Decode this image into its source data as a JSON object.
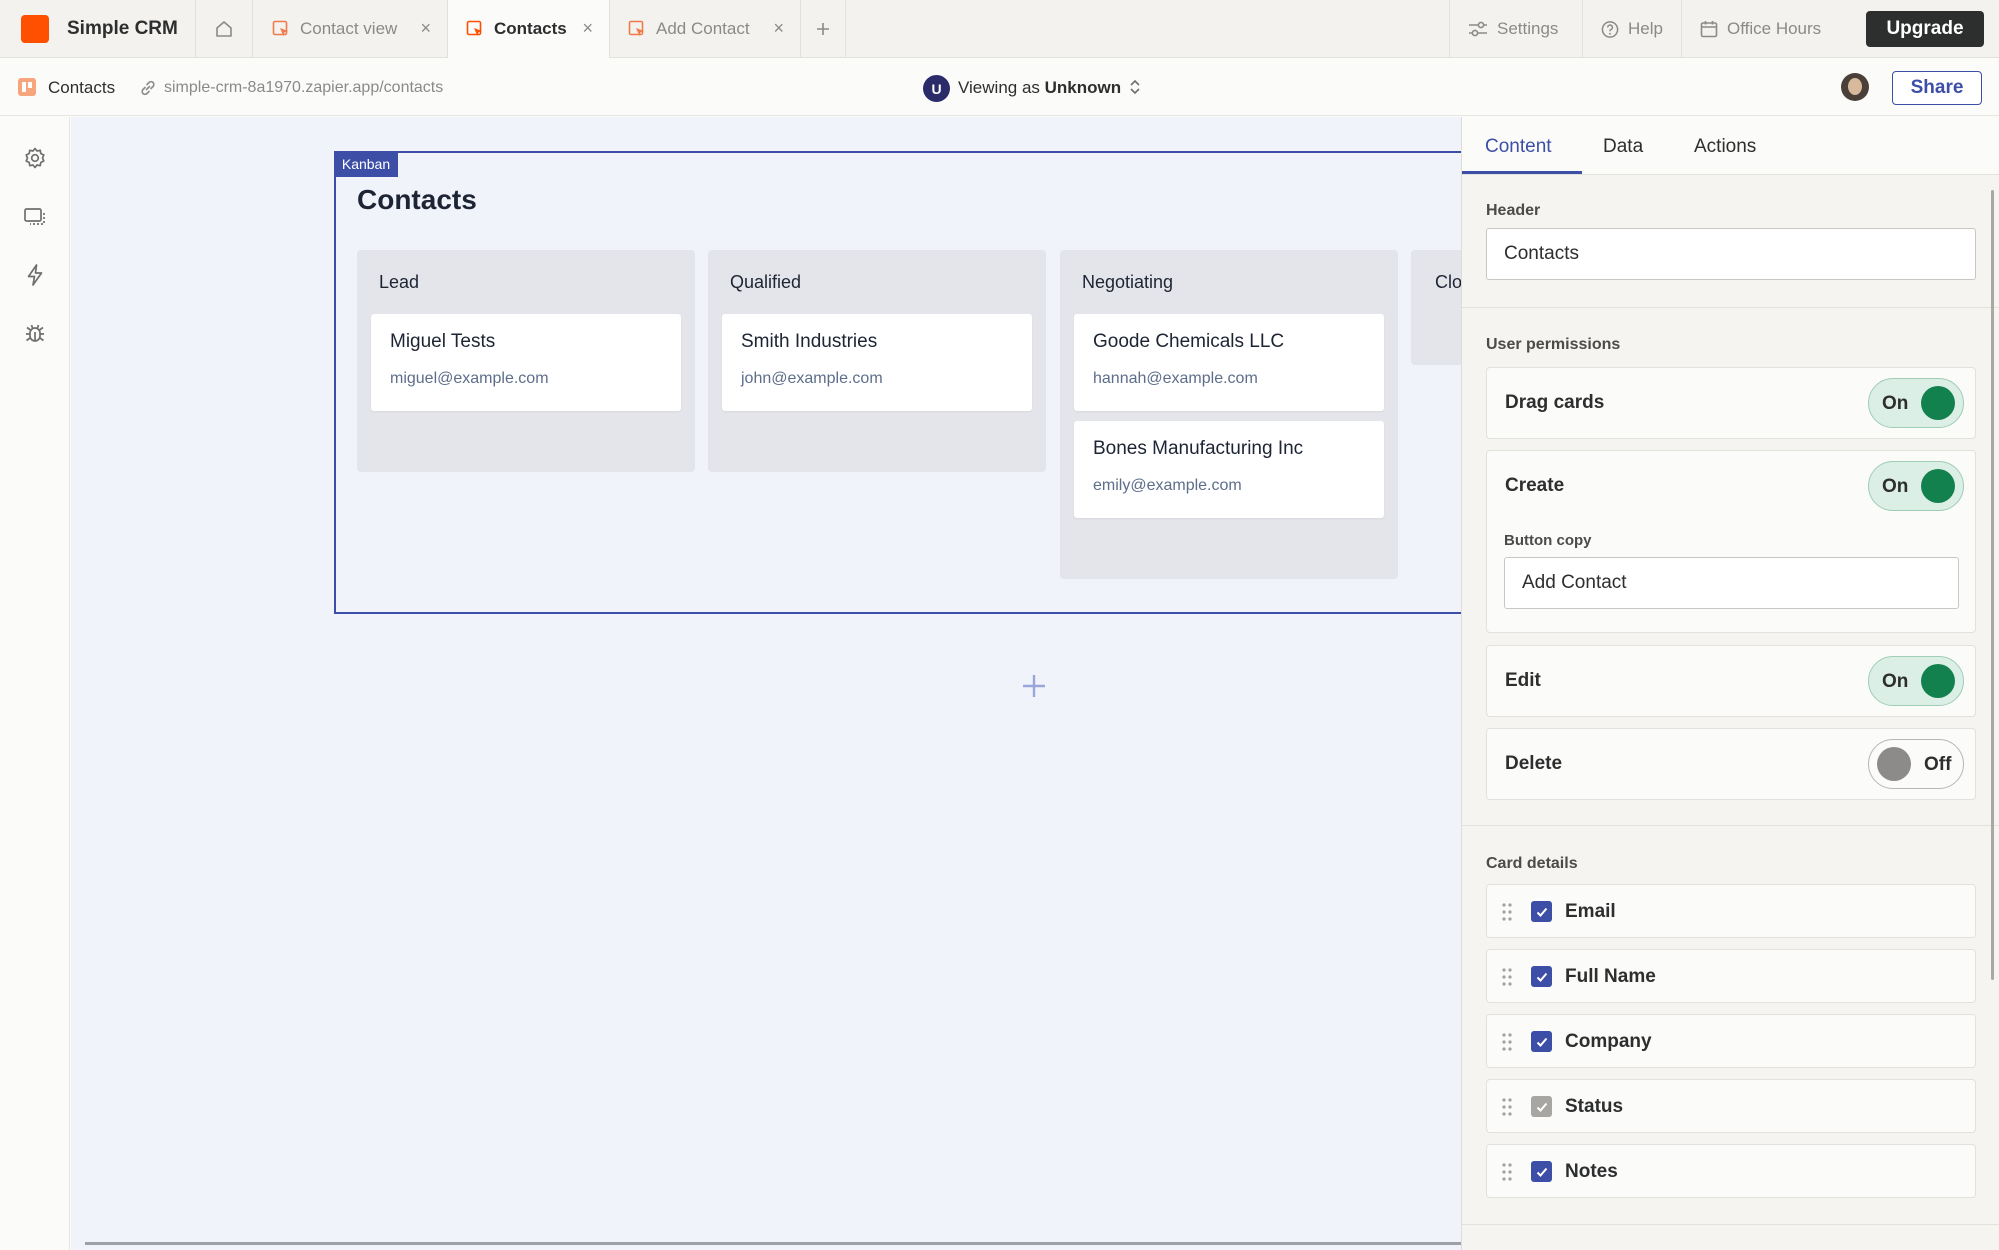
{
  "app": {
    "name": "Simple CRM"
  },
  "tabs": [
    {
      "label": "Contact view",
      "active": false
    },
    {
      "label": "Contacts",
      "active": true
    },
    {
      "label": "Add Contact",
      "active": false
    }
  ],
  "top_nav": {
    "settings": "Settings",
    "help": "Help",
    "office_hours": "Office Hours",
    "upgrade": "Upgrade"
  },
  "subbar": {
    "page_name": "Contacts",
    "url": "simple-crm-8a1970.zapier.app/contacts",
    "viewer_initial": "U",
    "viewing_prefix": "Viewing as",
    "viewing_role": "Unknown",
    "share": "Share"
  },
  "kanban": {
    "tag": "Kanban",
    "title": "Contacts",
    "columns": [
      {
        "title": "Lead",
        "cards": [
          {
            "name": "Miguel Tests",
            "email": "miguel@example.com"
          }
        ]
      },
      {
        "title": "Qualified",
        "cards": [
          {
            "name": "Smith Industries",
            "email": "john@example.com"
          }
        ]
      },
      {
        "title": "Negotiating",
        "cards": [
          {
            "name": "Goode Chemicals LLC",
            "email": "hannah@example.com"
          },
          {
            "name": "Bones Manufacturing Inc",
            "email": "emily@example.com"
          }
        ]
      },
      {
        "title": "Clo",
        "cards": []
      }
    ]
  },
  "panel": {
    "tabs": [
      "Content",
      "Data",
      "Actions"
    ],
    "active_tab": "Content",
    "header_label": "Header",
    "header_value": "Contacts",
    "permissions_label": "User permissions",
    "permissions": [
      {
        "label": "Drag cards",
        "state": "On"
      },
      {
        "label": "Create",
        "state": "On"
      },
      {
        "label": "Edit",
        "state": "On"
      },
      {
        "label": "Delete",
        "state": "Off"
      }
    ],
    "button_copy_label": "Button copy",
    "button_copy_value": "Add Contact",
    "card_details_label": "Card details",
    "card_details": [
      {
        "label": "Email",
        "checked": true
      },
      {
        "label": "Full Name",
        "checked": true
      },
      {
        "label": "Company",
        "checked": true
      },
      {
        "label": "Status",
        "checked": true,
        "disabled": true
      },
      {
        "label": "Notes",
        "checked": true
      }
    ]
  },
  "colors": {
    "brand": "#ff4f00",
    "accent": "#3d4ea6",
    "toggle_on": "#13814d",
    "toggle_off": "#8c8b89"
  },
  "icons": [
    "home-icon",
    "page-icon",
    "plus-icon",
    "settings-icon",
    "help-icon",
    "calendar-icon",
    "link-icon",
    "chevron-updown-icon",
    "gear-icon",
    "screens-icon",
    "lightning-icon",
    "bug-icon",
    "drag-handle-icon",
    "checkmark-icon"
  ]
}
